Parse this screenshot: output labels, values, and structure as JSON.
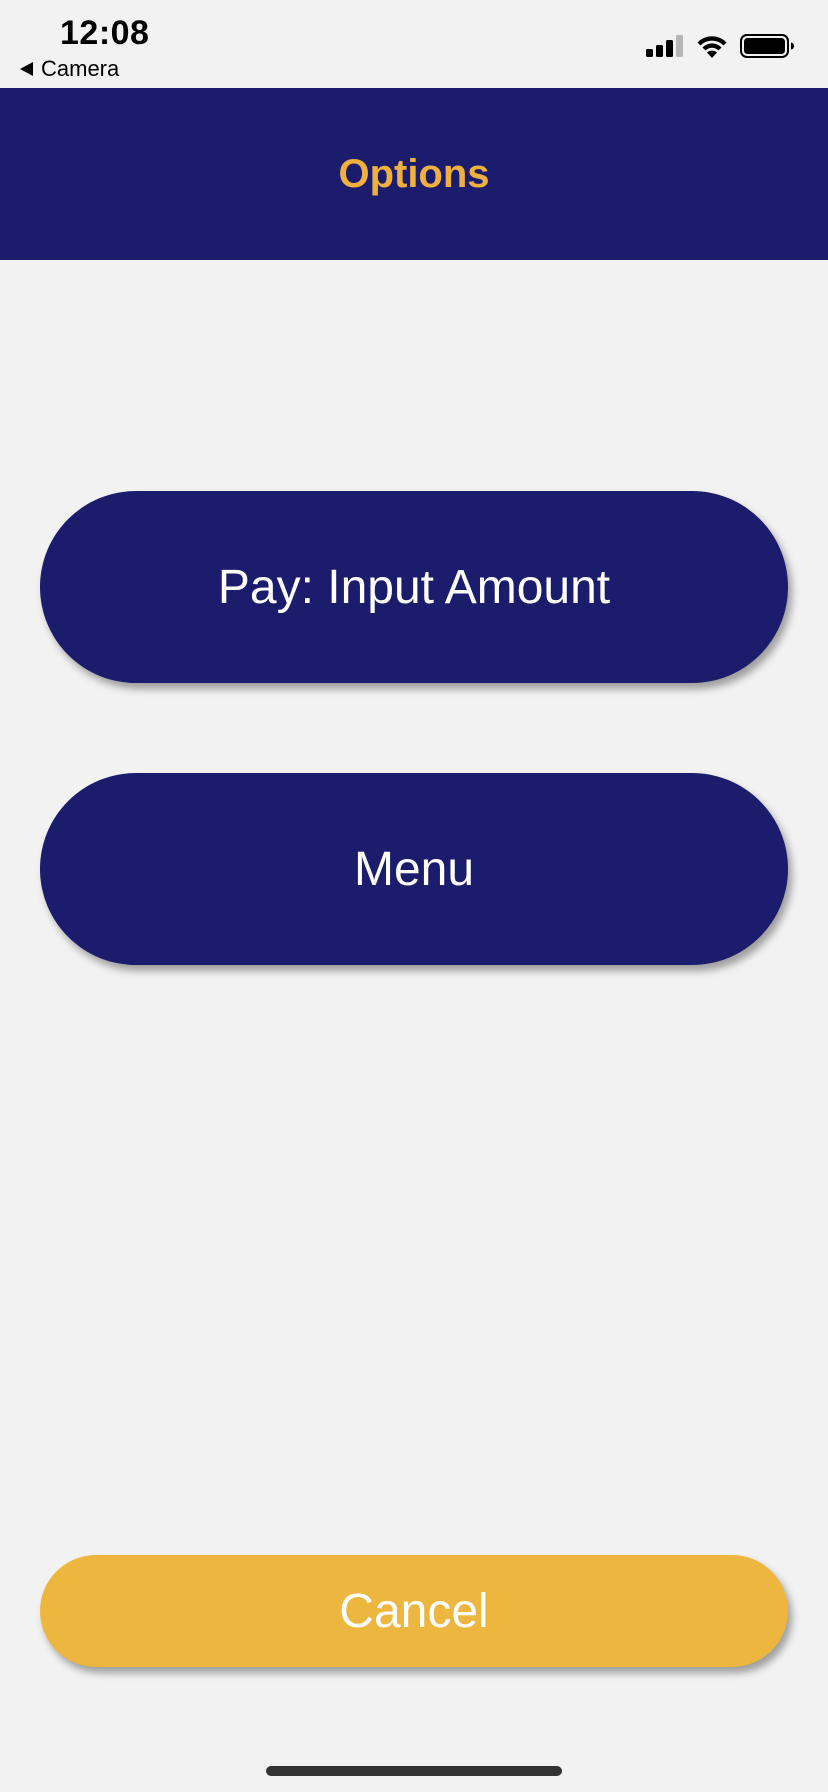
{
  "status_bar": {
    "time": "12:08",
    "back_app_label": "Camera",
    "icons": [
      "cellular-signal-icon",
      "wifi-icon",
      "battery-icon"
    ]
  },
  "header": {
    "title": "Options"
  },
  "buttons": {
    "pay_label": "Pay: Input Amount",
    "menu_label": "Menu",
    "cancel_label": "Cancel"
  },
  "colors": {
    "primary": "#1b1c6c",
    "accent_text": "#f0b040",
    "cancel": "#ecb63f",
    "background": "#f2f2f2"
  }
}
